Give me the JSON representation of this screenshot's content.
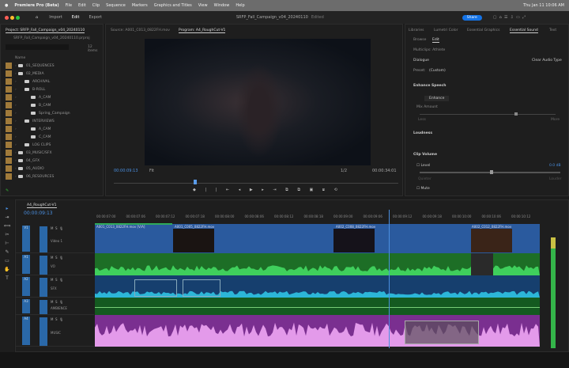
{
  "menubar": {
    "app": "Premiere Pro (Beta)",
    "items": [
      "File",
      "Edit",
      "Clip",
      "Sequence",
      "Markers",
      "Graphics and Titles",
      "View",
      "Window",
      "Help"
    ],
    "clock": "Thu Jan 11  10:06 AM"
  },
  "titlebar": {
    "nav": [
      "Import",
      "Edit",
      "Export"
    ],
    "active": "Edit",
    "title": "SRFP_Fall_Campaign_v04_20240110",
    "status": "Edited",
    "share": "Share"
  },
  "project": {
    "tab": "Project: SRFP_Fall_Campaign_v04_20240110",
    "path": "SRFP_Fall_Campaign_v04_20240110.prproj",
    "items_count": "12 items",
    "column": "Name",
    "items": [
      {
        "name": "01_SEQUENCES",
        "depth": 0
      },
      {
        "name": "02_MEDIA",
        "depth": 0
      },
      {
        "name": "ARCHIVAL",
        "depth": 1
      },
      {
        "name": "B-ROLL",
        "depth": 1
      },
      {
        "name": "A_CAM",
        "depth": 2
      },
      {
        "name": "B_CAM",
        "depth": 2
      },
      {
        "name": "Spring_Campaign",
        "depth": 2
      },
      {
        "name": "INTERVIEWS",
        "depth": 1
      },
      {
        "name": "A_CAM",
        "depth": 2
      },
      {
        "name": "C_CAM",
        "depth": 2
      },
      {
        "name": "LOG CLIPS",
        "depth": 1
      },
      {
        "name": "03_MUSIC/SFX",
        "depth": 0
      },
      {
        "name": "04_GFX",
        "depth": 0
      },
      {
        "name": "05_AUDIO",
        "depth": 0
      },
      {
        "name": "06_RESOURCES",
        "depth": 0
      }
    ]
  },
  "monitor": {
    "source_tab": "Source: A001_C013_0822FH.mov",
    "program_tab": "Program: A4_RoughCut-V1",
    "timecode": "00:00:09:13",
    "fit": "Fit",
    "resolution": "1/2",
    "duration": "00:00:34:01",
    "playhead_fraction": 0.28
  },
  "right": {
    "tabs": [
      "Libraries",
      "Lumetri Color",
      "Essential Graphics",
      "Essential Sound",
      "Text"
    ],
    "active": "Essential Sound",
    "subtabs": [
      "Browse",
      "Edit"
    ],
    "clip_name": "Multiclips: Athlete",
    "type": "Dialogue",
    "clear_type": "Clear Audio Type",
    "preset_label": "Preset:",
    "preset": "(Custom)",
    "enhance": "Enhance Speech",
    "enhance_btn": "Enhance",
    "mix_label": "Mix Amount",
    "mix_value": 0.7,
    "mix_min": "Less",
    "mix_max": "More",
    "loudness": "Loudness",
    "clip_volume": "Clip Volume",
    "level": "Level",
    "level_value": "0.0 dB",
    "level_fraction": 0.5,
    "quieter": "Quieter",
    "louder": "Louder",
    "mute": "Mute"
  },
  "timeline": {
    "tab": "A4_RoughCut-V1",
    "timecode": "00:00:09:13",
    "ruler": [
      "00:00:07:00",
      "00:00:07:06",
      "00:00:07:12",
      "00:00:07:18",
      "00:00:08:00",
      "00:00:08:06",
      "00:00:08:12",
      "00:00:08:18",
      "00:00:09:00",
      "00:00:09:06",
      "00:00:09:12",
      "00:00:09:18",
      "00:00:10:00",
      "00:00:10:06",
      "00:00:10:12"
    ],
    "tracks": [
      {
        "id": "V1",
        "name": "Video 1"
      },
      {
        "id": "A1",
        "name": "VO"
      },
      {
        "id": "A2",
        "name": "SFX"
      },
      {
        "id": "A3",
        "name": "AMBIENCE"
      },
      {
        "id": "A4",
        "name": "MUSIC"
      }
    ],
    "clips": [
      "A001_C013_0822FH.mov [V/A]",
      "A001_C005_0822FH.mov",
      "A002_C008_0822FH.mov",
      "A002_C012_0822FH.mov"
    ],
    "playhead_fraction": 0.66
  },
  "colors": {
    "video": "#2a5a9e",
    "vo": "#1e7a2a",
    "sfx": "#1a4a7a",
    "ambience": "#155a20",
    "music": "#8a3aa0",
    "accent": "#1473e6"
  }
}
